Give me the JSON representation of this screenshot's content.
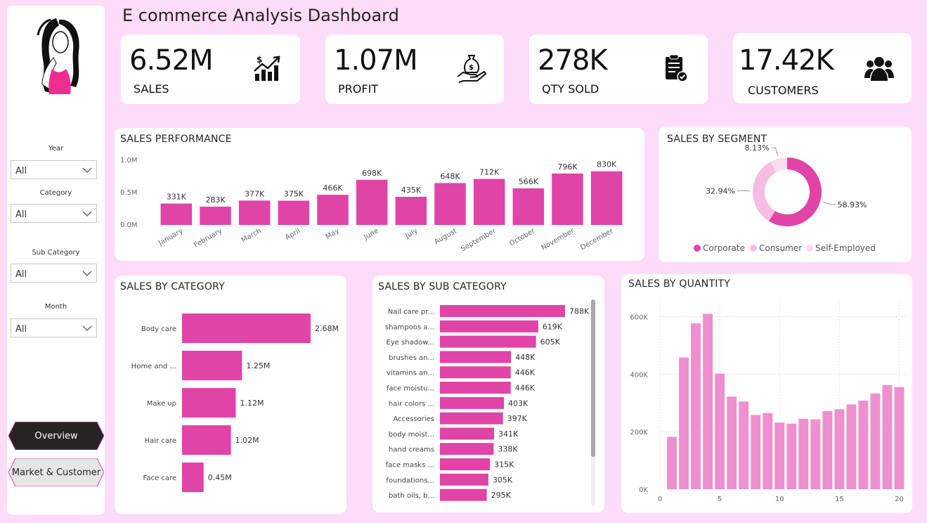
{
  "title": "E commerce Analysis Dashboard",
  "colors": {
    "accent": "#e044a7",
    "light": "#ee8fcf",
    "pale": "#fcd4ef",
    "background": "#fddcf9"
  },
  "kpis": [
    {
      "value": "6.52M",
      "label": "SALES",
      "icon": "trend-chart-icon"
    },
    {
      "value": "1.07M",
      "label": "PROFIT",
      "icon": "money-bag-hand-icon"
    },
    {
      "value": "278K",
      "label": "QTY SOLD",
      "icon": "clipboard-check-icon"
    },
    {
      "value": "17.42K",
      "label": "CUSTOMERS",
      "icon": "users-group-icon"
    }
  ],
  "filters": {
    "year": {
      "label": "Year",
      "value": "All"
    },
    "category": {
      "label": "Category",
      "value": "All"
    },
    "sub_category": {
      "label": "Sub Category",
      "value": "All"
    },
    "month": {
      "label": "Month",
      "value": "All"
    }
  },
  "nav": {
    "overview": "Overview",
    "market": "Market & Customer"
  },
  "panels": {
    "sales_performance": "SALES PERFORMANCE",
    "sales_by_segment": "SALES BY SEGMENT",
    "sales_by_category": "SALES BY CATEGORY",
    "sales_by_sub_category": "SALES BY SUB CATEGORY",
    "sales_by_quantity": "SALES BY QUANTITY"
  },
  "chart_data": [
    {
      "id": "sales_performance",
      "type": "bar",
      "title": "SALES PERFORMANCE",
      "categories": [
        "January",
        "February",
        "March",
        "April",
        "May",
        "June",
        "July",
        "August",
        "September",
        "October",
        "November",
        "December"
      ],
      "values": [
        331,
        283,
        377,
        375,
        466,
        698,
        435,
        648,
        712,
        566,
        796,
        830
      ],
      "data_labels": [
        "331K",
        "283K",
        "377K",
        "375K",
        "466K",
        "698K",
        "435K",
        "648K",
        "712K",
        "566K",
        "796K",
        "830K"
      ],
      "yticks": [
        "0.0M",
        "0.5M",
        "1.0M"
      ],
      "ylim": [
        0,
        1000
      ]
    },
    {
      "id": "sales_by_segment",
      "type": "pie",
      "title": "SALES BY SEGMENT",
      "labels": [
        "Corporate",
        "Consumer",
        "Self-Employed"
      ],
      "values": [
        58.93,
        32.94,
        8.13
      ],
      "data_labels": [
        "58.93%",
        "32.94%",
        "8.13%"
      ],
      "colors": [
        "#e044a7",
        "#f5bde3",
        "#fcdcf1"
      ],
      "legend": "bottom"
    },
    {
      "id": "sales_by_category",
      "type": "bar",
      "orientation": "horizontal",
      "title": "SALES BY CATEGORY",
      "categories": [
        "Body care",
        "Home and ...",
        "Make up",
        "Hair care",
        "Face care"
      ],
      "values": [
        2.68,
        1.25,
        1.12,
        1.02,
        0.45
      ],
      "data_labels": [
        "2.68M",
        "1.25M",
        "1.12M",
        "1.02M",
        "0.45M"
      ]
    },
    {
      "id": "sales_by_sub_category",
      "type": "bar",
      "orientation": "horizontal",
      "title": "SALES BY SUB CATEGORY",
      "categories": [
        "Nail care pr...",
        "shampoos a...",
        "Eye shadow...",
        "brushes an...",
        "vitamins an...",
        "face moistu...",
        "hair colors ...",
        "Accessories",
        "body moist...",
        "hand creams",
        "face masks ...",
        "foundations...",
        "bath oils, b..."
      ],
      "values": [
        788,
        619,
        605,
        448,
        446,
        446,
        403,
        397,
        341,
        338,
        315,
        305,
        295
      ],
      "data_labels": [
        "788K",
        "619K",
        "605K",
        "448K",
        "446K",
        "446K",
        "403K",
        "397K",
        "341K",
        "338K",
        "315K",
        "305K",
        "295K"
      ]
    },
    {
      "id": "sales_by_quantity",
      "type": "bar",
      "title": "SALES BY QUANTITY",
      "x": [
        1,
        2,
        3,
        4,
        5,
        6,
        7,
        8,
        9,
        10,
        11,
        12,
        13,
        14,
        15,
        16,
        17,
        18,
        19,
        20
      ],
      "values": [
        182,
        458,
        577,
        610,
        402,
        322,
        305,
        258,
        265,
        232,
        228,
        245,
        243,
        272,
        278,
        295,
        308,
        333,
        362,
        355
      ],
      "yticks": [
        "0K",
        "200K",
        "400K",
        "600K"
      ],
      "xticks": [
        "0",
        "5",
        "10",
        "15",
        "20"
      ],
      "ylim": [
        0,
        650
      ],
      "xlim": [
        0,
        20.5
      ]
    }
  ]
}
